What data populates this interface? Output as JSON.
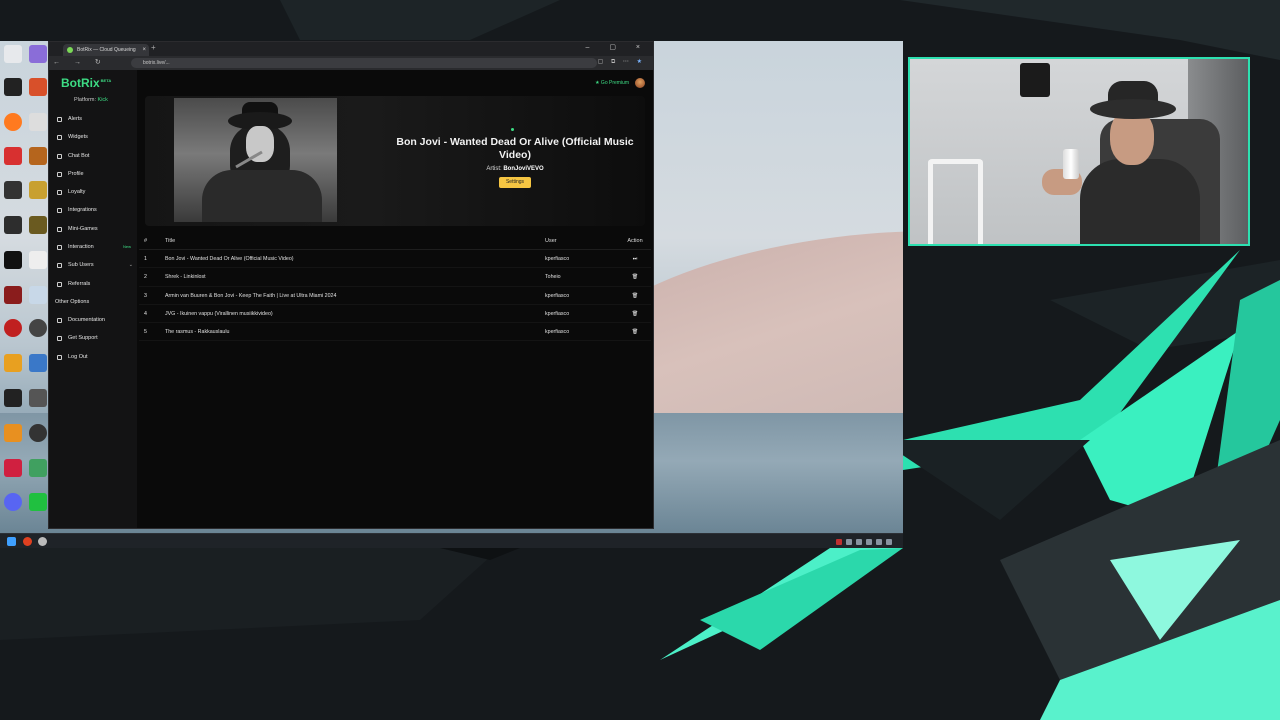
{
  "colors": {
    "accent": "#3ddc84",
    "settings_button": "#f5c542",
    "cam_border": "#2de0b0"
  },
  "browser": {
    "tab_title": "BotRix — Cloud Queueing",
    "tab_close": "×",
    "new_tab": "+",
    "address": "botrix.live/...",
    "window_controls": "– ▢ ×",
    "nav_buttons": "← → ↻"
  },
  "app": {
    "logo": "BotRix",
    "logo_badge": "BETA",
    "platform_label": "Platform:",
    "platform_value": "Kick",
    "go_premium": "★ Go Premium",
    "nav": [
      {
        "label": "Alerts",
        "icon": "bell-icon"
      },
      {
        "label": "Widgets",
        "icon": "widgets-icon"
      },
      {
        "label": "Chat Bot",
        "icon": "chat-icon"
      },
      {
        "label": "Profile",
        "icon": "profile-icon"
      },
      {
        "label": "Loyalty",
        "icon": "loyalty-icon"
      },
      {
        "label": "Integrations",
        "icon": "integrations-icon"
      },
      {
        "label": "Mini-Games",
        "icon": "games-icon"
      },
      {
        "label": "Interaction",
        "icon": "music-icon",
        "badge": "New"
      },
      {
        "label": "Sub Users",
        "icon": "users-icon"
      },
      {
        "label": "Referrals",
        "icon": "referrals-icon"
      }
    ],
    "other_section": "Other Options",
    "other_nav": [
      {
        "label": "Documentation",
        "icon": "docs-icon"
      },
      {
        "label": "Get Support",
        "icon": "support-icon"
      },
      {
        "label": "Log Out",
        "icon": "logout-icon"
      }
    ],
    "now_playing": {
      "title": "Bon Jovi - Wanted Dead Or Alive (Official Music Video)",
      "artist_label": "Artist:",
      "artist": "BonJoviVEVO",
      "settings": "Settings"
    },
    "queue": {
      "headers": {
        "num": "#",
        "title": "Title",
        "user": "User",
        "action": "Action"
      },
      "rows": [
        {
          "num": "1",
          "title": "Bon Jovi - Wanted Dead Or Alive (Official Music Video)",
          "user": "kperfiasco",
          "action": "⏭"
        },
        {
          "num": "2",
          "title": "Shrek - Linkinlost",
          "user": "Toheio",
          "action": "🗑"
        },
        {
          "num": "3",
          "title": "Armin van Buuren & Bon Jovi - Keep The Faith | Live at Ultra Miami 2024",
          "user": "kperfiasco",
          "action": "🗑"
        },
        {
          "num": "4",
          "title": "JVG - Ikuinen vappu (Virallinen musiikkivideo)",
          "user": "kperfiasco",
          "action": "🗑"
        },
        {
          "num": "5",
          "title": "The rasmus - Rakkauslaulu",
          "user": "kperfiasco",
          "action": "🗑"
        }
      ]
    }
  }
}
